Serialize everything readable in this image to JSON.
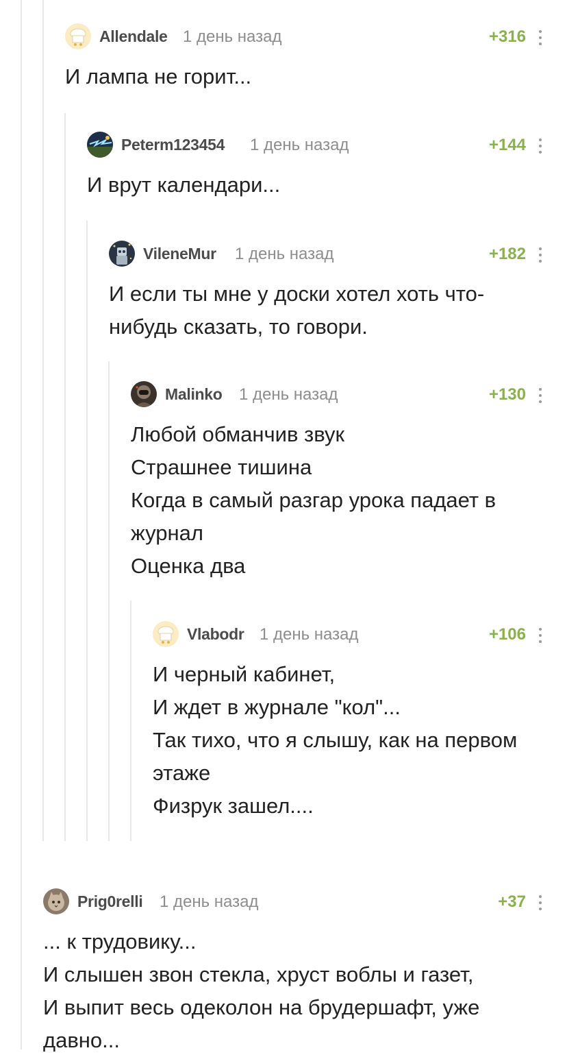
{
  "comments": [
    {
      "author": "Allendale",
      "time": "1 день назад",
      "rating": "+316",
      "avatar_icon": "chef-hat-avatar-icon",
      "lines": [
        "И лампа не горит..."
      ]
    },
    {
      "author": "Peterm123454",
      "time": "1 день назад",
      "rating": "+144",
      "avatar_icon": "lightning-landscape-avatar-icon",
      "lines": [
        "И врут календари..."
      ]
    },
    {
      "author": "VileneMur",
      "time": "1 день назад",
      "rating": "+182",
      "avatar_icon": "robot-avatar-icon",
      "lines": [
        "И если ты мне у доски хотел хоть что-",
        "нибудь сказать, то говори."
      ]
    },
    {
      "author": "Malinko",
      "time": "1 день назад",
      "rating": "+130",
      "avatar_icon": "astronaut-avatar-icon",
      "lines": [
        "Любой обманчив звук",
        "Страшнее тишина",
        "Когда в самый разгар урока падает в",
        "журнал",
        "Оценка два"
      ]
    },
    {
      "author": "Vlabodr",
      "time": "1 день назад",
      "rating": "+106",
      "avatar_icon": "chef-hat-avatar-icon",
      "lines": [
        "И черный кабинет,",
        "И ждет в журнале \"кол\"...",
        "Так тихо, что я слышу, как на первом",
        "этаже",
        "Физрук зашел...."
      ]
    },
    {
      "author": "Prig0relli",
      "time": "1 день назад",
      "rating": "+37",
      "avatar_icon": "cat-avatar-icon",
      "lines": [
        "... к трудовику...",
        "И слышен звон стекла, хруст воблы и газет,",
        "И выпит весь одеколон на брудершафт, уже",
        "давно..."
      ]
    }
  ],
  "colors": {
    "rating": "#8bb04f",
    "author": "#4b4b4b",
    "time": "#8d8d8d",
    "thread_line": "#e8e8e8"
  }
}
